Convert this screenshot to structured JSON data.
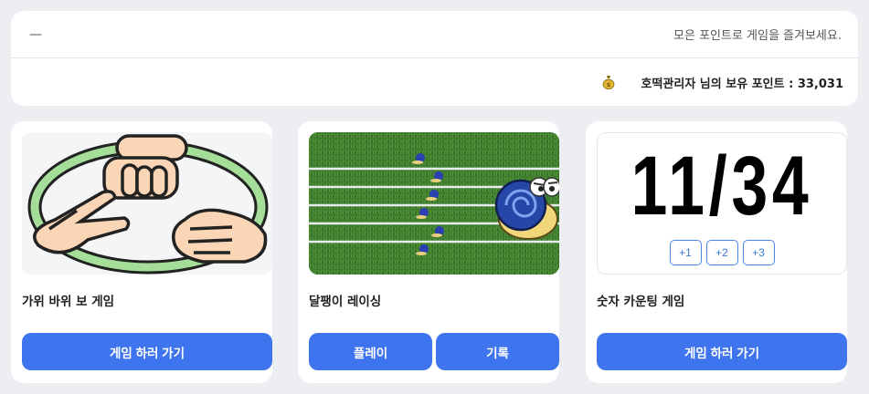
{
  "header": {
    "menu_dash": "—",
    "notice": "모은 포인트로 게임을 즐겨보세요.",
    "points_text": "호떡관리자 님의 보유 포인트 : 33,031",
    "money_icon": "money-bag-icon"
  },
  "cards": [
    {
      "title": "가위 바위 보 게임",
      "image": "rock-paper-scissors-hands",
      "button": "게임 하러 가기"
    },
    {
      "title": "달팽이 레이싱",
      "image": "snail-race-track",
      "buttons": [
        "플레이",
        "기록"
      ]
    },
    {
      "title": "숫자 카운팅 게임",
      "counter": "11/34",
      "increments": [
        "+1",
        "+2",
        "+3"
      ],
      "button": "게임 하러 가기"
    }
  ],
  "colors": {
    "primary": "#3f74ef",
    "background": "#eceef2",
    "grass": "#3c7a2c"
  }
}
